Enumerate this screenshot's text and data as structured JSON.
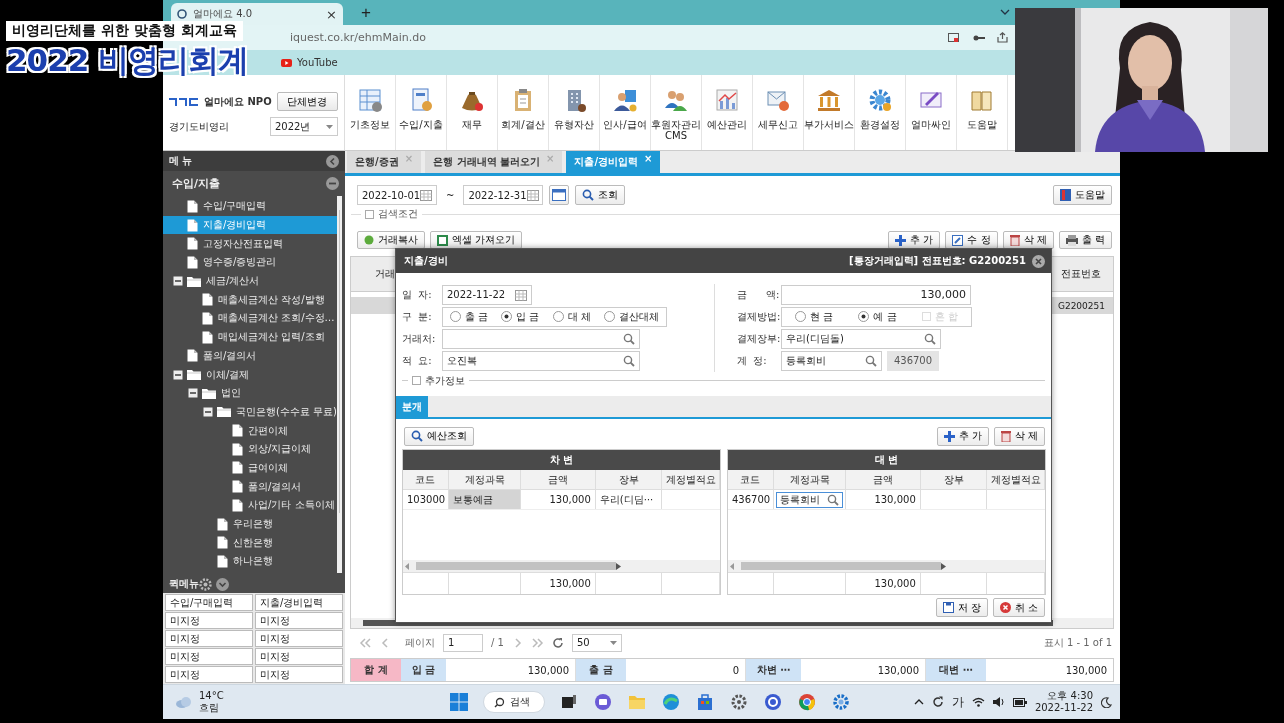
{
  "video_caption": {
    "subtitle": "비영리단체를 위한 맞춤형 회계교육",
    "title": "2022 비영리회계"
  },
  "browser": {
    "tab_title": "얼마에요 4.0",
    "tab_close": "×",
    "new_tab": "+",
    "address": "iquest.co.kr/ehmMain.do",
    "bookmarks": [
      "YouTube"
    ]
  },
  "app_header": {
    "brand": "얼마에요 NPO",
    "change_org_button": "단체변경",
    "org_name": "경기도비영리",
    "year": "2022년",
    "modules": [
      {
        "label": "기초정보"
      },
      {
        "label": "수입/지출"
      },
      {
        "label": "재무"
      },
      {
        "label": "회계/결산"
      },
      {
        "label": "유형자산"
      },
      {
        "label": "인사/급여"
      },
      {
        "label": "후원자관리 CMS"
      },
      {
        "label": "예산관리"
      },
      {
        "label": "세무신고"
      },
      {
        "label": "부가서비스"
      },
      {
        "label": "환경설정"
      },
      {
        "label": "얼마싸인"
      },
      {
        "label": "도움말"
      }
    ]
  },
  "sidebar": {
    "title": "메 뉴",
    "section": "수입/지출",
    "tree": [
      {
        "label": "수입/구매입력",
        "selected": false
      },
      {
        "label": "지출/경비입력",
        "selected": true
      },
      {
        "label": "고정자산전표입력",
        "selected": false
      },
      {
        "label": "영수증/증빙관리",
        "selected": false
      },
      {
        "label": "세금/계산서",
        "selected": false,
        "expanded": true,
        "children": [
          {
            "label": "매출세금계산 작성/발행",
            "selected": false
          },
          {
            "label": "매출세금계산 조회/수정…",
            "selected": false
          },
          {
            "label": "매입세금계산 입력/조회",
            "selected": false
          }
        ]
      },
      {
        "label": "품의/결의서",
        "selected": false
      },
      {
        "label": "이체/결제",
        "selected": false,
        "expanded": true,
        "children": [
          {
            "label": "법인",
            "selected": false,
            "expanded": true,
            "children": [
              {
                "label": "국민은행(수수료 무료)",
                "selected": false,
                "expanded": true,
                "children": [
                  {
                    "label": "간편이체",
                    "selected": false
                  },
                  {
                    "label": "외상/지급이체",
                    "selected": false
                  },
                  {
                    "label": "급여이체",
                    "selected": false
                  },
                  {
                    "label": "품의/결의서",
                    "selected": false
                  },
                  {
                    "label": "사업/기타 소득이체",
                    "selected": false
                  }
                ]
              },
              {
                "label": "우리은행",
                "selected": false
              },
              {
                "label": "신한은행",
                "selected": false
              },
              {
                "label": "하나은행",
                "selected": false
              }
            ]
          }
        ]
      }
    ],
    "quick_menu_title": "퀵메뉴",
    "quick_menu": [
      "수입/구매입력",
      "지출/경비입력",
      "미지정",
      "미지정",
      "미지정",
      "미지정",
      "미지정",
      "미지정",
      "미지정",
      "미지정"
    ]
  },
  "tabs": [
    {
      "label": "은행/증권",
      "selected": false,
      "close": "×"
    },
    {
      "label": "은행 거래내역 불러오기",
      "selected": false,
      "close": "×"
    },
    {
      "label": "지출/경비입력",
      "selected": true,
      "close": "×"
    }
  ],
  "filter": {
    "date_from": "2022-10-01",
    "range_sep": "~",
    "date_to": "2022-12-31",
    "search_button": "조회",
    "help_button": "도움말",
    "search_options": {
      "label": "검색조건",
      "checked": false
    }
  },
  "toolbar": {
    "left": [
      "거래복사",
      "엑셀 가져오기"
    ],
    "right": [
      "추 가",
      "수 정",
      "삭 제",
      "출 력"
    ]
  },
  "grid": {
    "columns": [
      "거래",
      "전표번호"
    ],
    "rows": [
      {
        "voucher_no": "G2200251",
        "selected": true
      }
    ]
  },
  "pager": {
    "page_label": "페이지",
    "page": "1",
    "total_pages": "/ 1",
    "page_size": "50",
    "summary": "표시 1 - 1 of 1"
  },
  "totals": [
    {
      "kind": "title",
      "label": "합 계"
    },
    {
      "kind": "sum",
      "label": "입 금",
      "value": "130,000"
    },
    {
      "kind": "sum",
      "label": "출 금",
      "value": "0"
    },
    {
      "kind": "sum",
      "label": "차변 ⋯",
      "value": "130,000"
    },
    {
      "kind": "sum",
      "label": "대변 ⋯",
      "value": "130,000"
    }
  ],
  "dialog": {
    "title": "지출/경비",
    "info": "[통장거래입력] 전표번호: G2200251",
    "date": {
      "label": "일  자:",
      "value": "2022-11-22"
    },
    "type": {
      "label": "구  분:",
      "options": [
        {
          "label": "출 금",
          "selected": false
        },
        {
          "label": "입 금",
          "selected": true
        },
        {
          "label": "대 체",
          "selected": false
        },
        {
          "label": "결산대체",
          "selected": false
        }
      ]
    },
    "vendor": {
      "label": "거래처:"
    },
    "memo": {
      "label": "적  요:",
      "value": "오진복"
    },
    "amount": {
      "label": "금      액:",
      "value": "130,000"
    },
    "payment": {
      "label": "결제방법:",
      "options": [
        {
          "label": "현 금",
          "selected": false
        },
        {
          "label": "예 금",
          "selected": true
        }
      ],
      "mixed": {
        "label": "혼 합",
        "checked": false,
        "disabled": true
      }
    },
    "ledger": {
      "label": "결제장부:",
      "value": "우리(디딤돌)"
    },
    "account": {
      "label": "계  정:",
      "value": "등록회비",
      "code": "436700"
    },
    "extra_info": {
      "label": "추가정보",
      "checked": false
    },
    "tabs": [
      {
        "label": "분개",
        "selected": true
      }
    ],
    "budget_button": "예산조회",
    "add_button": "추 가",
    "delete_button": "삭 제",
    "debit": {
      "title": "차 변",
      "columns": [
        "코드",
        "계정과목",
        "금액",
        "장부",
        "계정별적요"
      ],
      "rows": [
        {
          "code": "103000",
          "account": "보통예금",
          "amount": "130,000",
          "ledger": "우리(디딤⋯",
          "highlighted": true,
          "editing": false
        }
      ],
      "total": "130,000"
    },
    "credit": {
      "title": "대 변",
      "columns": [
        "코드",
        "계정과목",
        "금액",
        "장부",
        "계정별적요"
      ],
      "rows": [
        {
          "code": "436700",
          "account": "등록회비",
          "amount": "130,000",
          "highlighted": false,
          "editing": true
        }
      ],
      "total": "130,000"
    },
    "save_button": "저 장",
    "cancel_button": "취 소"
  },
  "taskbar": {
    "weather": {
      "temp": "14°C",
      "condition": "흐림"
    },
    "search": "검색",
    "ime": "가",
    "time": "오후 4:30",
    "date": "2022-11-22"
  }
}
